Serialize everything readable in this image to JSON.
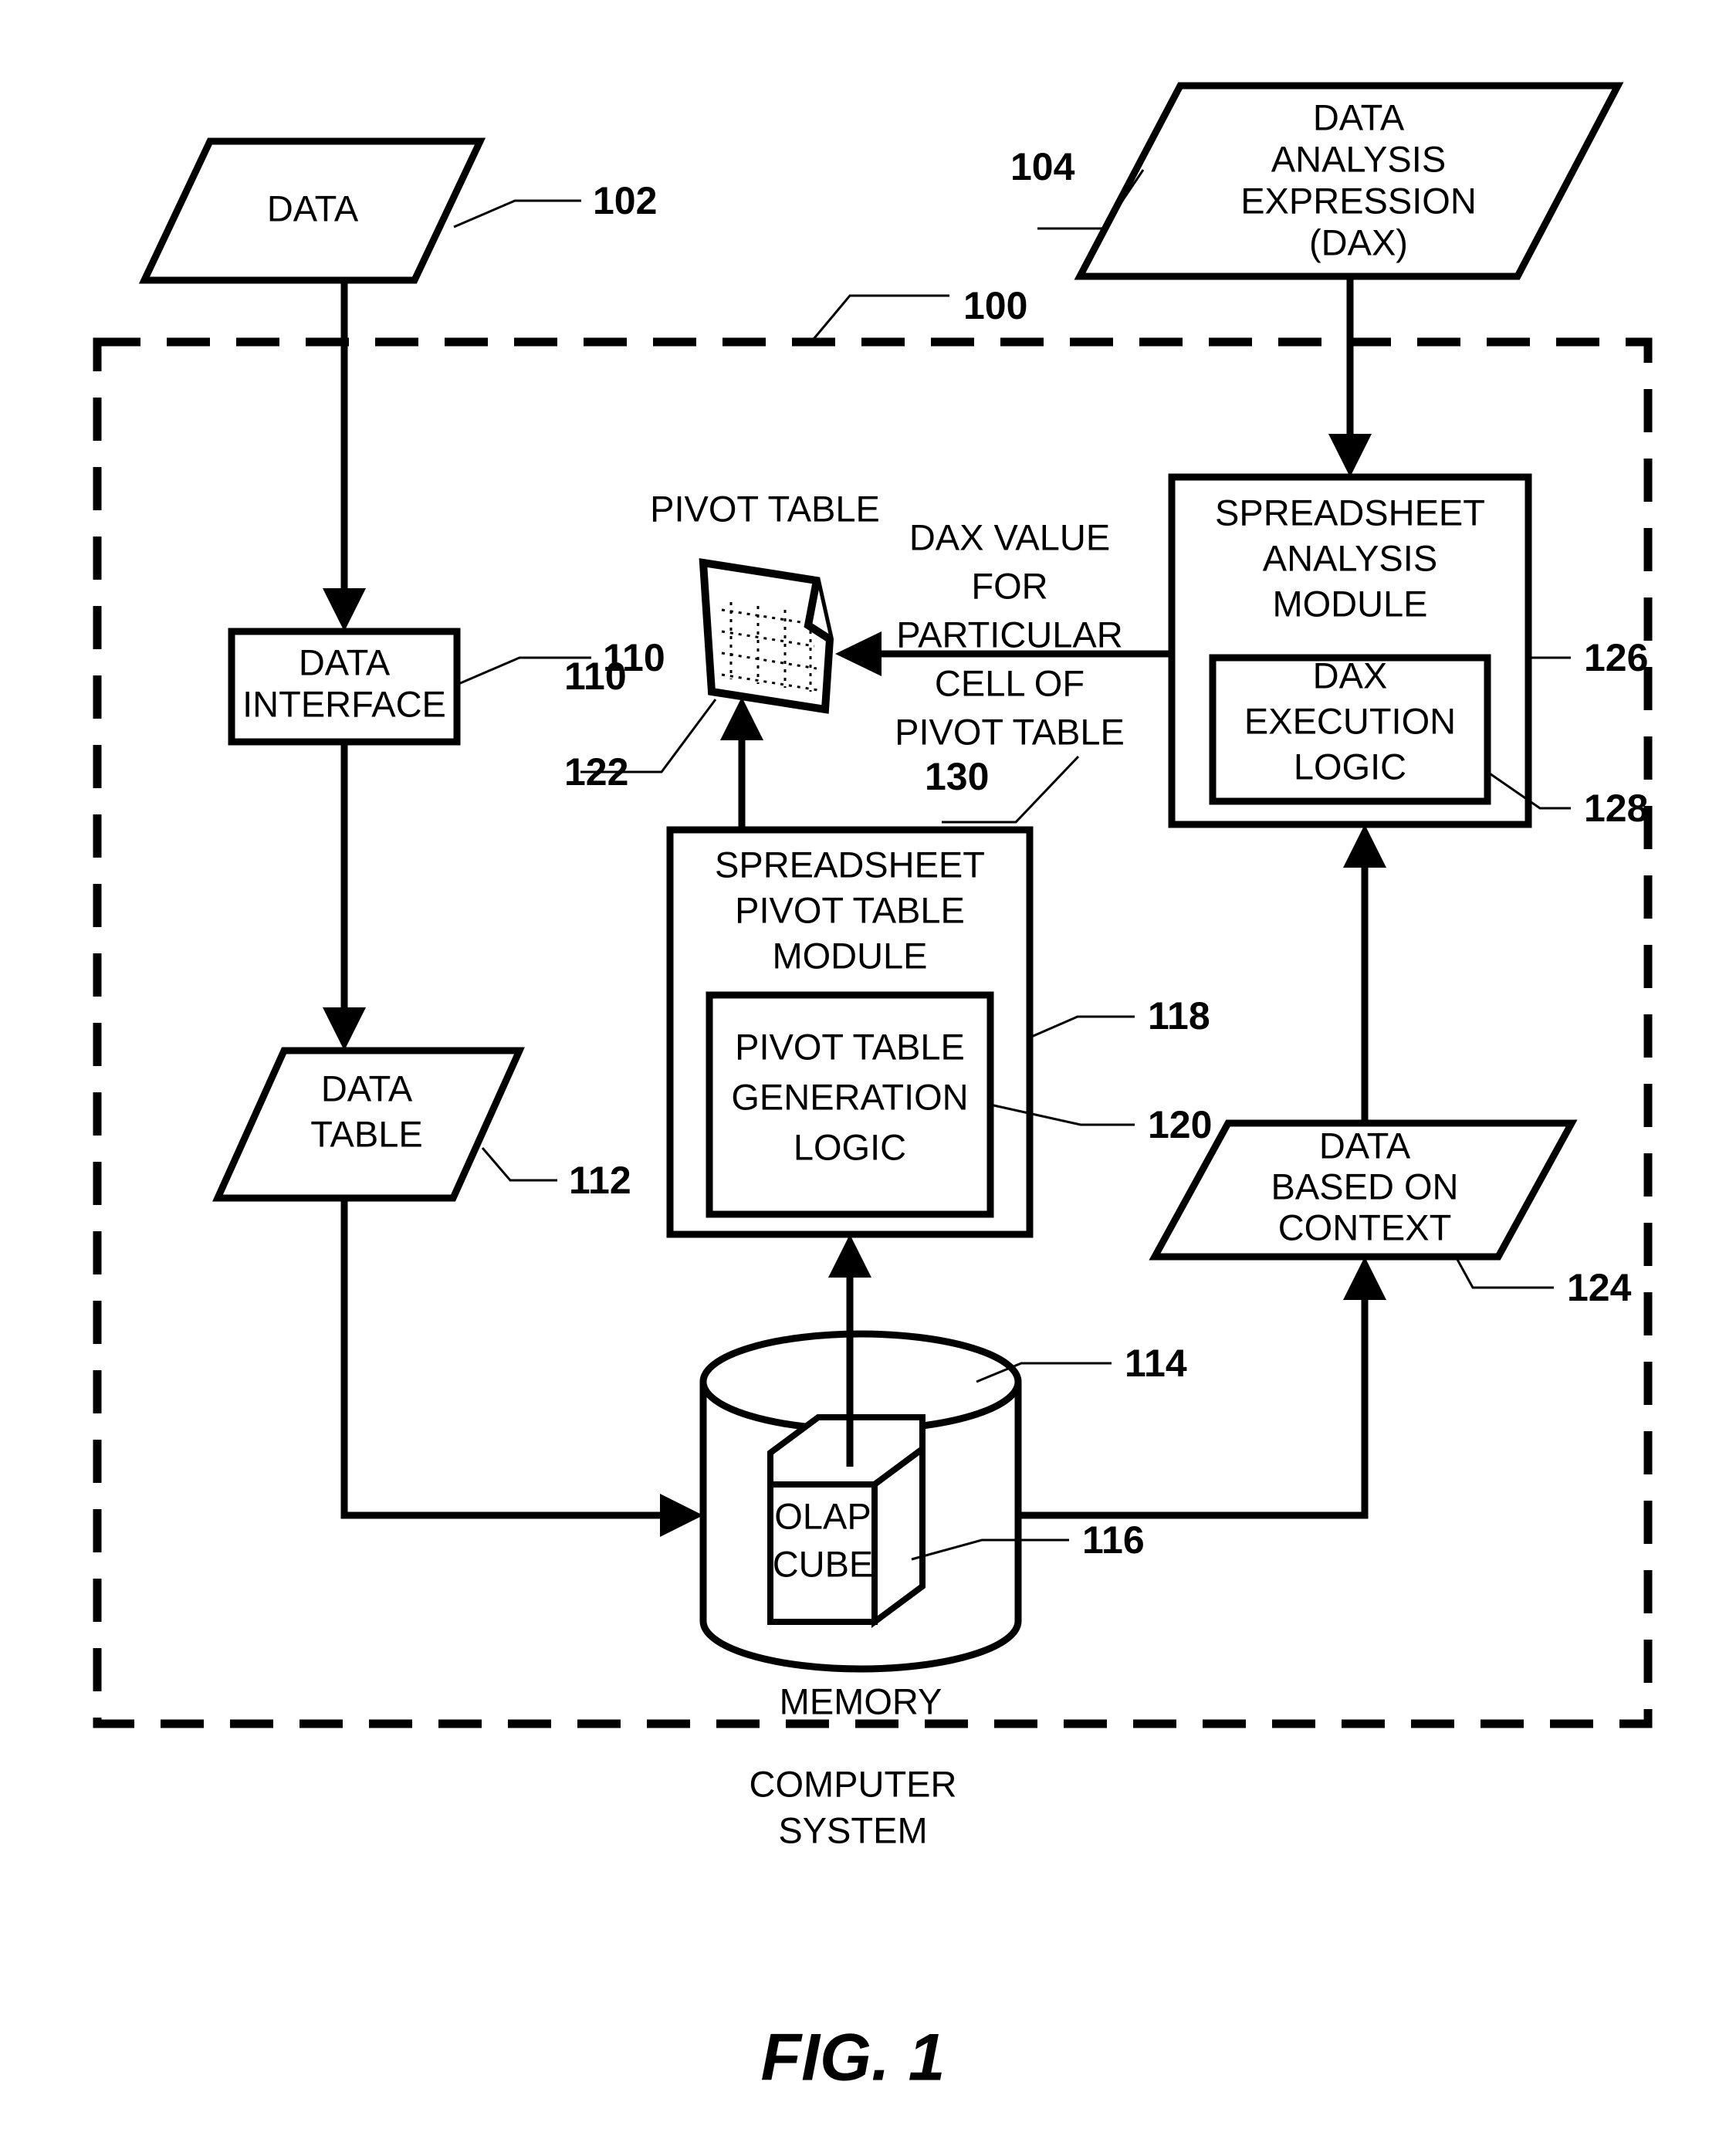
{
  "figure": {
    "caption": "FIG. 1",
    "system_boundary_label": "COMPUTER SYSTEM",
    "system_boundary_ref": "100"
  },
  "nodes": {
    "data_input": {
      "label": "DATA",
      "ref": "102",
      "shape": "parallelogram"
    },
    "dax_input": {
      "label_line1": "DATA",
      "label_line2": "ANALYSIS",
      "label_line3": "EXPRESSION",
      "label_line4": "(DAX)",
      "ref": "104",
      "shape": "parallelogram"
    },
    "data_interface": {
      "label_line1": "DATA",
      "label_line2": "INTERFACE",
      "ref": "110",
      "shape": "rectangle"
    },
    "data_table": {
      "label_line1": "DATA",
      "label_line2": "TABLE",
      "ref": "112",
      "shape": "parallelogram"
    },
    "pivot_table": {
      "title": "PIVOT TABLE",
      "ref": "122",
      "secondary_ref": "110",
      "shape": "document"
    },
    "spreadsheet_pivot_table_module": {
      "label_line1": "SPREADSHEET",
      "label_line2": "PIVOT TABLE",
      "label_line3": "MODULE",
      "ref": "118",
      "shape": "rectangle"
    },
    "pivot_table_generation_logic": {
      "label_line1": "PIVOT TABLE",
      "label_line2": "GENERATION",
      "label_line3": "LOGIC",
      "ref": "120",
      "shape": "rectangle"
    },
    "spreadsheet_analysis_module": {
      "label_line1": "SPREADSHEET",
      "label_line2": "ANALYSIS",
      "label_line3": "MODULE",
      "ref": "126",
      "shape": "rectangle"
    },
    "dax_execution_logic": {
      "label_line1": "DAX",
      "label_line2": "EXECUTION",
      "label_line3": "LOGIC",
      "ref": "128",
      "shape": "rectangle"
    },
    "memory": {
      "label": "MEMORY",
      "ref": "114",
      "shape": "cylinder"
    },
    "olap_cube": {
      "label_line1": "OLAP",
      "label_line2": "CUBE",
      "ref": "116",
      "shape": "cube"
    },
    "data_based_on_context": {
      "label_line1": "DATA",
      "label_line2": "BASED ON",
      "label_line3": "CONTEXT",
      "ref": "124",
      "shape": "parallelogram"
    }
  },
  "annotations": {
    "dax_value_flow": {
      "line1": "DAX VALUE",
      "line2": "FOR",
      "line3": "PARTICULAR",
      "line4": "CELL OF",
      "line5": "PIVOT TABLE",
      "ref": "130"
    }
  },
  "colors": {
    "stroke": "#000000",
    "background": "#ffffff"
  }
}
